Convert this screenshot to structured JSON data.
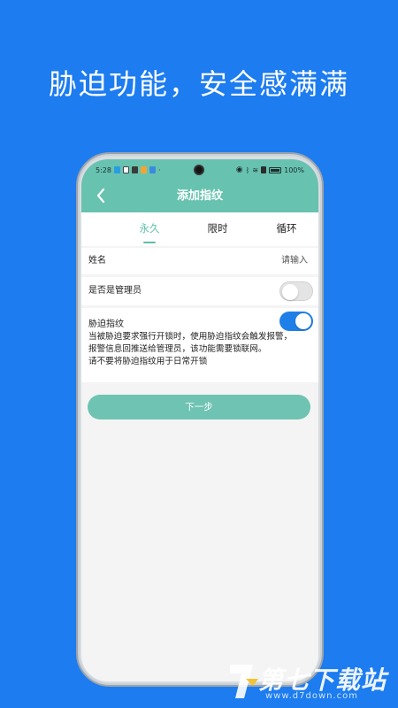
{
  "banner": {
    "headline": "胁迫功能，安全感满满"
  },
  "status_bar": {
    "time": "5:28",
    "battery_percent": "100%"
  },
  "header": {
    "title": "添加指纹",
    "back_icon": "chevron-left-icon"
  },
  "tabs": [
    {
      "label": "永久",
      "active": true
    },
    {
      "label": "限时",
      "active": false
    },
    {
      "label": "循环",
      "active": false
    }
  ],
  "form": {
    "name": {
      "label": "姓名",
      "placeholder": "请输入"
    },
    "admin": {
      "label": "是否是管理员",
      "enabled": false
    },
    "duress": {
      "label": "胁迫指纹",
      "enabled": true,
      "description_lines": [
        "当被胁迫要求强行开锁时，使用胁迫指纹会触发报警，",
        "报警信息回推送给管理员，该功能需要锁联网。",
        "请不要将胁迫指纹用于日常开锁"
      ]
    }
  },
  "actions": {
    "next_label": "下一步"
  },
  "watermark": {
    "name": "第七下载站",
    "url": "www.d7down.com"
  },
  "colors": {
    "background": "#1c7cf0",
    "accent": "#68c2b0",
    "toggle_on": "#1f7fe8",
    "toggle_off": "#e4e4e4"
  }
}
